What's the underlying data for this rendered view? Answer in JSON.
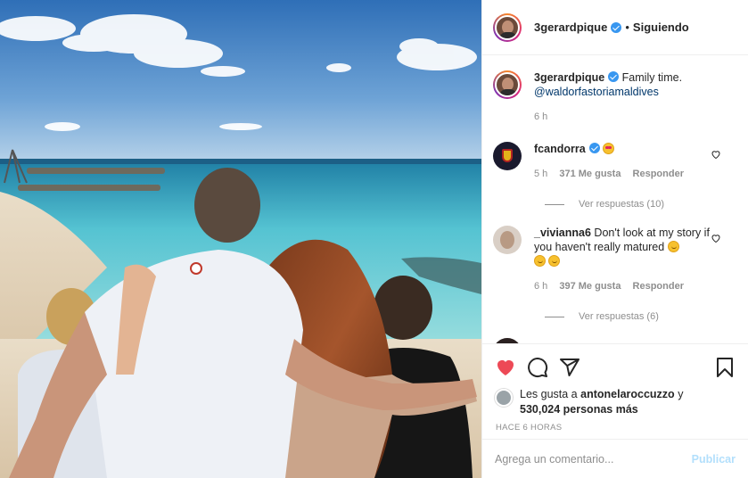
{
  "post": {
    "username": "3gerardpique",
    "follow_status": "Siguiendo",
    "separator": "•",
    "caption_text": "Family time.",
    "caption_mention": "@waldorfastoriamaldives",
    "caption_time": "6 h"
  },
  "comments": [
    {
      "username": "fcandorra",
      "text": "",
      "time": "5 h",
      "likes": "371 Me gusta",
      "reply_label": "Responder",
      "view_replies": "Ver respuestas (10)"
    },
    {
      "username": "_vivianna6",
      "text": "Don't look at my story if you haven't really matured",
      "time": "6 h",
      "likes": "397 Me gusta",
      "reply_label": "Responder",
      "view_replies": "Ver respuestas (6)"
    }
  ],
  "likes": {
    "prefix": "Les gusta a",
    "user": "antonelaroccuzzo",
    "conj": "y",
    "count": "530,024 personas más"
  },
  "timestamp": "HACE 6 HORAS",
  "comment_box": {
    "placeholder": "Agrega un comentario...",
    "publish_label": "Publicar"
  },
  "icons": {
    "like": "heart-icon",
    "comment": "comment-icon",
    "share": "share-icon",
    "save": "bookmark-icon"
  },
  "colors": {
    "liked": "#ed4956",
    "link": "#00376b",
    "publish_disabled": "#b2dffc",
    "verified": "#3897f0"
  }
}
